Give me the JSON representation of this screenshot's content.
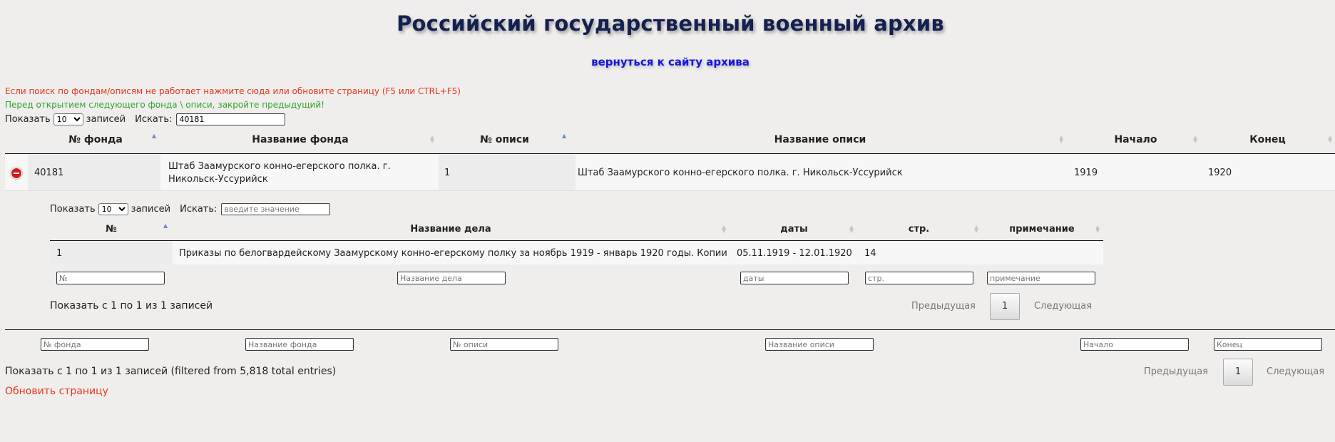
{
  "header": {
    "title": "Российский государственный военный архив",
    "back_link": "вернуться к сайту архива"
  },
  "notices": {
    "red": "Если поиск по фондам/описям не работает нажмите сюда или обновите страницу (F5 или CTRL+F5)",
    "green": "Перед открытием следующего фонда \\ описи, закройте предыдущий!"
  },
  "main_controls": {
    "show_label": "Показать",
    "length_value": "10",
    "entries_label": "записей",
    "search_label": "Искать:",
    "search_value": "40181"
  },
  "main_table": {
    "columns": [
      "№ фонда",
      "Название фонда",
      "№ описи",
      "Название описи",
      "Начало",
      "Конец"
    ],
    "rows": [
      {
        "fond_no": "40181",
        "fond_name_line1": "Штаб Заамурского конно-егерского полка. г.",
        "fond_name_line2": "Никольск-Уссурийск",
        "opis_no": "1",
        "opis_name": "Штаб Заамурского конно-егерского полка. г. Никольск-Уссурийск",
        "start": "1919",
        "end": "1920"
      }
    ],
    "filters": [
      "№ фонда",
      "Название фонда",
      "№ описи",
      "Название описи",
      "Начало",
      "Конец"
    ],
    "info": "Показать с 1 по 1 из 1 записей (filtered from 5,818 total entries)",
    "prev": "Предыдущая",
    "page": "1",
    "next": "Следующая"
  },
  "sub_controls": {
    "show_label": "Показать",
    "length_value": "10",
    "entries_label": "записей",
    "search_label": "Искать:",
    "search_placeholder": "введите значение"
  },
  "sub_table": {
    "columns": [
      "№",
      "Название дела",
      "даты",
      "стр.",
      "примечание"
    ],
    "rows": [
      {
        "no": "1",
        "name": "Приказы по белогвардейскому Заамурскому конно-егерскому полку за ноябрь 1919 - январь 1920 годы. Копии",
        "dates": "05.11.1919 - 12.01.1920",
        "pages": "14",
        "note": ""
      }
    ],
    "filters": [
      "№",
      "Название дела",
      "даты",
      "стр.",
      "примечание"
    ],
    "info": "Показать с 1 по 1 из 1 записей",
    "prev": "Предыдущая",
    "page": "1",
    "next": "Следующая"
  },
  "footer": {
    "refresh": "Обновить страницу"
  },
  "colors": {
    "background": "#efeeed",
    "title": "#16204f",
    "link": "#1515e0",
    "warning_red": "#e8341c",
    "notice_green": "#2fa52a"
  }
}
